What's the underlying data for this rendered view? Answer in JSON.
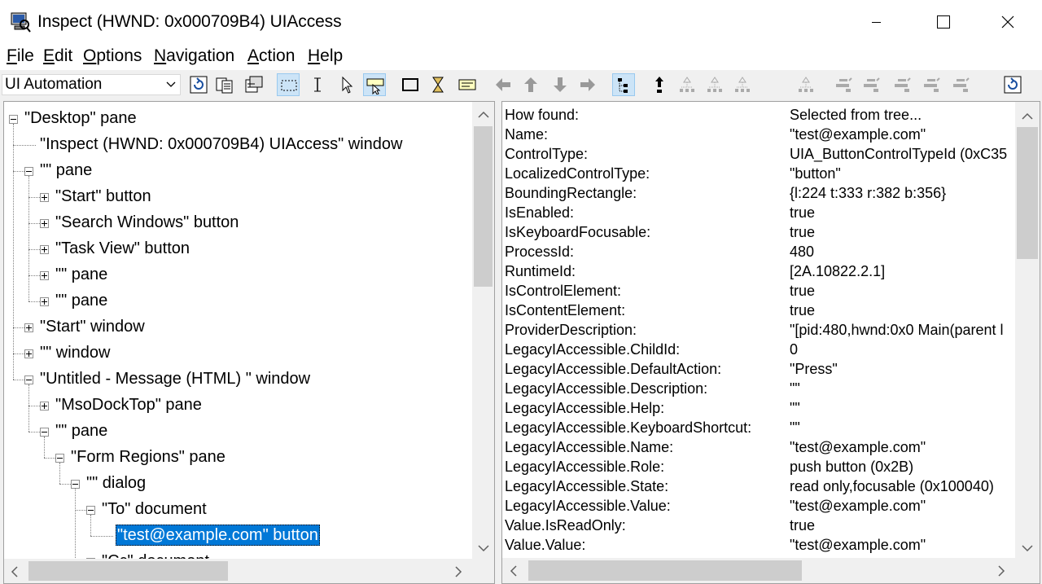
{
  "window": {
    "title": "Inspect  (HWND: 0x000709B4) UIAccess"
  },
  "menu": [
    {
      "label": "File",
      "key": "F",
      "rest": "ile"
    },
    {
      "label": "Edit",
      "key": "E",
      "rest": "dit"
    },
    {
      "label": "Options",
      "key": "O",
      "rest": "ptions"
    },
    {
      "label": "Navigation",
      "key": "N",
      "rest": "avigation"
    },
    {
      "label": "Action",
      "key": "A",
      "rest": "ction"
    },
    {
      "label": "Help",
      "key": "H",
      "rest": "elp"
    }
  ],
  "toolbar": {
    "mode_value": "UI Automation",
    "icons": [
      "refresh-icon",
      "copy-icon",
      "copy-tree-icon",
      "watch-focus-icon",
      "watch-caret-icon",
      "watch-cursor-icon",
      "watch-tooltip-icon",
      "highlight-rectangle-icon",
      "show-hourglass-icon",
      "show-info-tip-icon",
      "nav-previous-icon",
      "nav-parent-icon",
      "nav-child-icon",
      "nav-next-icon",
      "show-tree-icon",
      "nav-up-icon",
      "tree-walk-1-icon",
      "tree-walk-2-icon",
      "tree-walk-3-icon",
      "tree-walk-4-icon",
      "action-1-icon",
      "action-2-icon",
      "action-3-icon",
      "action-4-icon",
      "action-5-icon",
      "refresh-tree-icon"
    ]
  },
  "tree": {
    "nodes": [
      {
        "label": "\"Desktop\" pane",
        "level": 0,
        "expander": "minus"
      },
      {
        "label": "\"Inspect  (HWND: 0x000709B4) UIAccess\" window",
        "level": 1,
        "expander": "none"
      },
      {
        "label": "\"\" pane",
        "level": 1,
        "expander": "minus"
      },
      {
        "label": "\"Start\" button",
        "level": 2,
        "expander": "plus"
      },
      {
        "label": "\"Search Windows\" button",
        "level": 2,
        "expander": "plus"
      },
      {
        "label": "\"Task View\" button",
        "level": 2,
        "expander": "plus"
      },
      {
        "label": "\"\" pane",
        "level": 2,
        "expander": "plus"
      },
      {
        "label": "\"\" pane",
        "level": 2,
        "expander": "plus"
      },
      {
        "label": "\"Start\" window",
        "level": 1,
        "expander": "plus"
      },
      {
        "label": "\"\" window",
        "level": 1,
        "expander": "plus"
      },
      {
        "label": "\"Untitled - Message (HTML) \" window",
        "level": 1,
        "expander": "minus"
      },
      {
        "label": "\"MsoDockTop\" pane",
        "level": 2,
        "expander": "plus"
      },
      {
        "label": "\"\" pane",
        "level": 2,
        "expander": "minus"
      },
      {
        "label": "\"Form Regions\" pane",
        "level": 3,
        "expander": "minus"
      },
      {
        "label": "\"\" dialog",
        "level": 4,
        "expander": "minus"
      },
      {
        "label": "\"To\" document",
        "level": 5,
        "expander": "minus"
      },
      {
        "label": "\"test@example.com\" button",
        "level": 6,
        "expander": "none",
        "selected": true
      },
      {
        "label": "\"Cc\" document",
        "level": 5,
        "expander": "plus"
      }
    ]
  },
  "properties": [
    {
      "name": "How found:",
      "value": "Selected from tree..."
    },
    {
      "name": "Name:",
      "value": "\"test@example.com\""
    },
    {
      "name": "ControlType:",
      "value": "UIA_ButtonControlTypeId (0xC35"
    },
    {
      "name": "LocalizedControlType:",
      "value": "\"button\""
    },
    {
      "name": "BoundingRectangle:",
      "value": "{l:224 t:333 r:382 b:356}"
    },
    {
      "name": "IsEnabled:",
      "value": "true"
    },
    {
      "name": "IsKeyboardFocusable:",
      "value": "true"
    },
    {
      "name": "ProcessId:",
      "value": "480"
    },
    {
      "name": "RuntimeId:",
      "value": "[2A.10822.2.1]"
    },
    {
      "name": "IsControlElement:",
      "value": "true"
    },
    {
      "name": "IsContentElement:",
      "value": "true"
    },
    {
      "name": "ProviderDescription:",
      "value": "\"[pid:480,hwnd:0x0 Main(parent l"
    },
    {
      "name": "LegacyIAccessible.ChildId:",
      "value": "0"
    },
    {
      "name": "LegacyIAccessible.DefaultAction:",
      "value": "\"Press\""
    },
    {
      "name": "LegacyIAccessible.Description:",
      "value": "\"\""
    },
    {
      "name": "LegacyIAccessible.Help:",
      "value": "\"\""
    },
    {
      "name": "LegacyIAccessible.KeyboardShortcut:",
      "value": "\"\""
    },
    {
      "name": "LegacyIAccessible.Name:",
      "value": "\"test@example.com\""
    },
    {
      "name": "LegacyIAccessible.Role:",
      "value": "push button (0x2B)"
    },
    {
      "name": "LegacyIAccessible.State:",
      "value": "read only,focusable (0x100040)"
    },
    {
      "name": "LegacyIAccessible.Value:",
      "value": "\"test@example.com\""
    },
    {
      "name": "Value.IsReadOnly:",
      "value": "true"
    },
    {
      "name": "Value.Value:",
      "value": "\"test@example.com\""
    }
  ]
}
